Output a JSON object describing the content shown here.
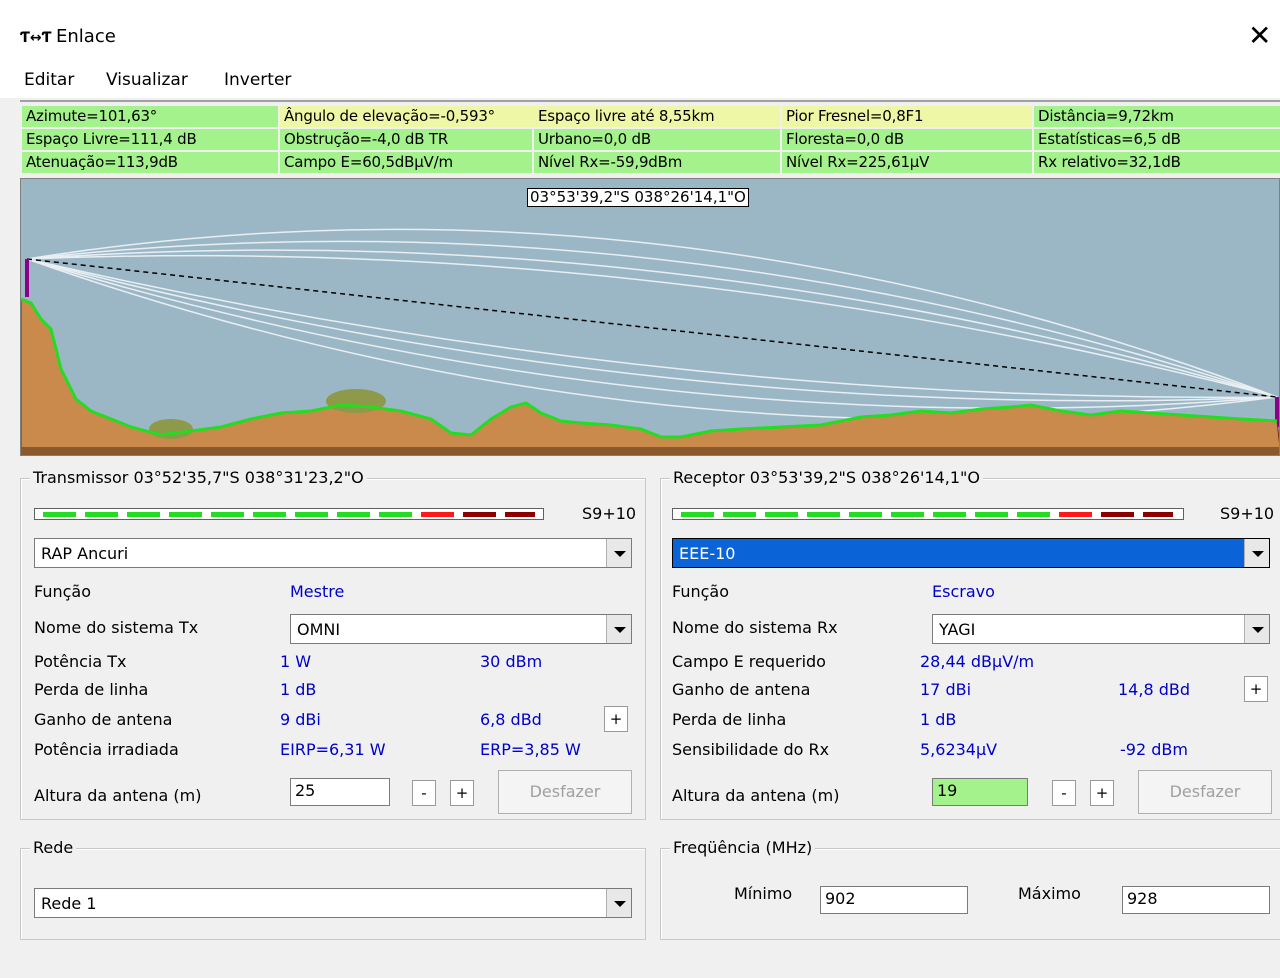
{
  "window": {
    "title": "Enlace",
    "icon_text": "Ƭ↔Ƭ"
  },
  "menu": [
    "Editar",
    "Visualizar",
    "Inverter"
  ],
  "info": {
    "row1": [
      "Azimute=101,63°",
      "Ângulo de elevação=-0,593°",
      "Espaço livre até 8,55km",
      "Pior Fresnel=0,8F1",
      "Distância=9,72km"
    ],
    "row2": [
      "Espaço Livre=111,4 dB",
      "Obstrução=-4,0 dB TR",
      "Urbano=0,0 dB",
      "Floresta=0,0 dB",
      "Estatísticas=6,5 dB"
    ],
    "row3": [
      "Atenuação=113,9dB",
      "Campo E=60,5dBµV/m",
      "Nível Rx=-59,9dBm",
      "Nível Rx=225,61µV",
      "Rx relativo=32,1dB"
    ]
  },
  "profile": {
    "coord_tag": "03°53'39,2\"S 038°26'14,1\"O"
  },
  "transmitter": {
    "title": "Transmissor 03°52'35,7\"S 038°31'23,2\"O",
    "meter_value": "S9+10",
    "site": "RAP Ancuri",
    "funcao_label": "Função",
    "funcao_value": "Mestre",
    "sistema_label": "Nome do sistema Tx",
    "sistema_value": "OMNI",
    "potencia_label": "Potência Tx",
    "potencia_w": "1 W",
    "potencia_dbm": "30 dBm",
    "perda_label": "Perda de linha",
    "perda_value": "1 dB",
    "ganho_label": "Ganho de antena",
    "ganho_dbi": "9 dBi",
    "ganho_dbd": "6,8 dBd",
    "irradiada_label": "Potência irradiada",
    "eirp": "EIRP=6,31 W",
    "erp": "ERP=3,85 W",
    "altura_label": "Altura da antena (m)",
    "altura_value": "25",
    "minus": "-",
    "plus": "+",
    "undo": "Desfazer",
    "ganho_plus": "+"
  },
  "receiver": {
    "title": "Receptor 03°53'39,2\"S 038°26'14,1\"O",
    "meter_value": "S9+10",
    "site": "EEE-10",
    "funcao_label": "Função",
    "funcao_value": "Escravo",
    "sistema_label": "Nome do sistema Rx",
    "sistema_value": "YAGI",
    "campo_label": "Campo E requerido",
    "campo_value": "28,44 dBµV/m",
    "ganho_label": "Ganho de antena",
    "ganho_dbi": "17 dBi",
    "ganho_dbd": "14,8 dBd",
    "perda_label": "Perda de linha",
    "perda_value": "1 dB",
    "sens_label": "Sensibilidade do Rx",
    "sens_uv": "5,6234µV",
    "sens_dbm": "-92 dBm",
    "altura_label": "Altura da antena (m)",
    "altura_value": "19",
    "minus": "-",
    "plus": "+",
    "undo": "Desfazer",
    "ganho_plus": "+"
  },
  "rede": {
    "title": "Rede",
    "value": "Rede 1"
  },
  "freq": {
    "title": "Freqüência (MHz)",
    "min_label": "Mínimo",
    "min_value": "902",
    "max_label": "Máximo",
    "max_value": "928"
  },
  "colors": {
    "green": "#a4f28c",
    "yellow": "#eef7a6",
    "sky": "#9bb7c6",
    "terrain": "#c98a4b",
    "profile_line": "#22dd22",
    "selection": "#0a64d8"
  }
}
